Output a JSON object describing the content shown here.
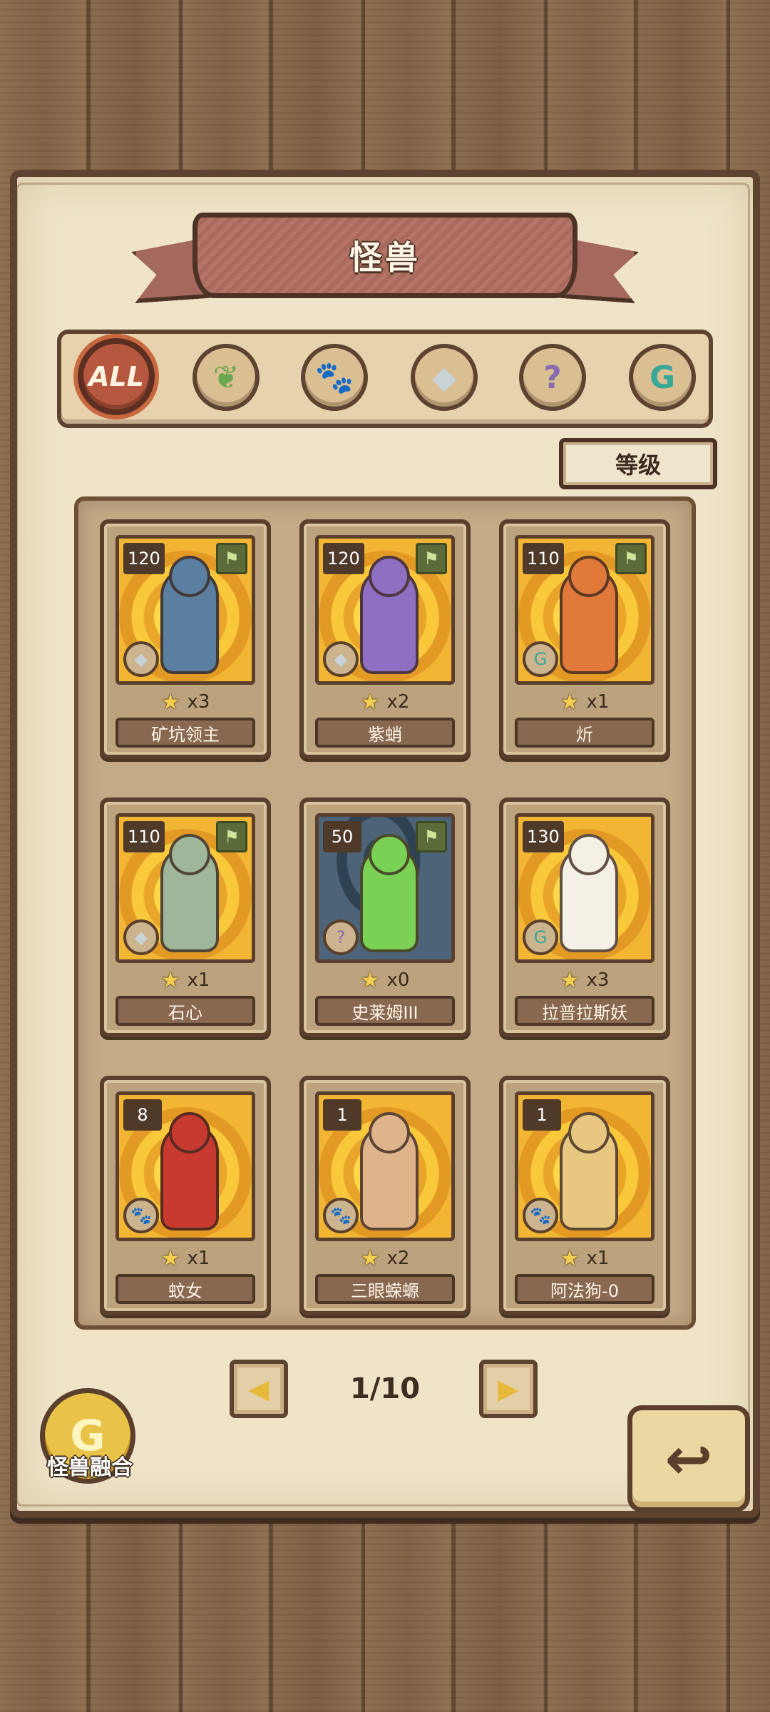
{
  "title": "怪兽",
  "filters": [
    {
      "label": "ALL",
      "icon": "all-icon",
      "active": true
    },
    {
      "label": "",
      "icon": "leaf-icon",
      "glyph": "❦",
      "color": "#6aa84f"
    },
    {
      "label": "",
      "icon": "paw-icon",
      "glyph": "🐾",
      "color": "#e3a52c"
    },
    {
      "label": "",
      "icon": "crystal-icon",
      "glyph": "◆",
      "color": "#c9d3d6"
    },
    {
      "label": "",
      "icon": "question-icon",
      "glyph": "?",
      "color": "#8a6bb0"
    },
    {
      "label": "",
      "icon": "spiral-icon",
      "glyph": "G",
      "color": "#3aa896"
    }
  ],
  "sort_label": "等级",
  "cards": [
    {
      "level": "120",
      "count": "x3",
      "name": "矿坑领主",
      "type_icon": "crystal-icon",
      "flag": true,
      "art": "gold",
      "creature_color": "#5a7fa0"
    },
    {
      "level": "120",
      "count": "x2",
      "name": "紫蛸",
      "type_icon": "crystal-icon",
      "flag": true,
      "art": "gold",
      "creature_color": "#8f6fc1"
    },
    {
      "level": "110",
      "count": "x1",
      "name": "炘",
      "type_icon": "spiral-icon",
      "flag": true,
      "art": "gold",
      "creature_color": "#e0793a"
    },
    {
      "level": "110",
      "count": "x1",
      "name": "石心",
      "type_icon": "crystal-icon",
      "flag": true,
      "art": "gold",
      "creature_color": "#9fb69a"
    },
    {
      "level": "50",
      "count": "x0",
      "name": "史莱姆III",
      "type_icon": "question-icon",
      "flag": true,
      "art": "dark",
      "creature_color": "#7bd155"
    },
    {
      "level": "130",
      "count": "x3",
      "name": "拉普拉斯妖",
      "type_icon": "spiral-icon",
      "flag": false,
      "art": "gold",
      "creature_color": "#f4f0e6"
    },
    {
      "level": "8",
      "count": "x1",
      "name": "蚊女",
      "type_icon": "paw-icon",
      "flag": false,
      "art": "gold",
      "creature_color": "#c83a2f"
    },
    {
      "level": "1",
      "count": "x2",
      "name": "三眼蝾螈",
      "type_icon": "paw-icon",
      "flag": false,
      "art": "gold",
      "creature_color": "#e0b48a"
    },
    {
      "level": "1",
      "count": "x1",
      "name": "阿法狗-0",
      "type_icon": "paw-icon",
      "flag": false,
      "art": "gold",
      "creature_color": "#e8c780"
    }
  ],
  "pagination": {
    "label": "1/10",
    "prev": "◀",
    "next": "▶"
  },
  "fusion_label": "怪兽融合",
  "fusion_glyph": "G",
  "back_glyph": "↩",
  "star_glyph": "★",
  "flag_glyph": "⚑",
  "colors": {
    "accent": "#b5583f",
    "panel": "#efe3c8",
    "wood": "#5d4330"
  }
}
